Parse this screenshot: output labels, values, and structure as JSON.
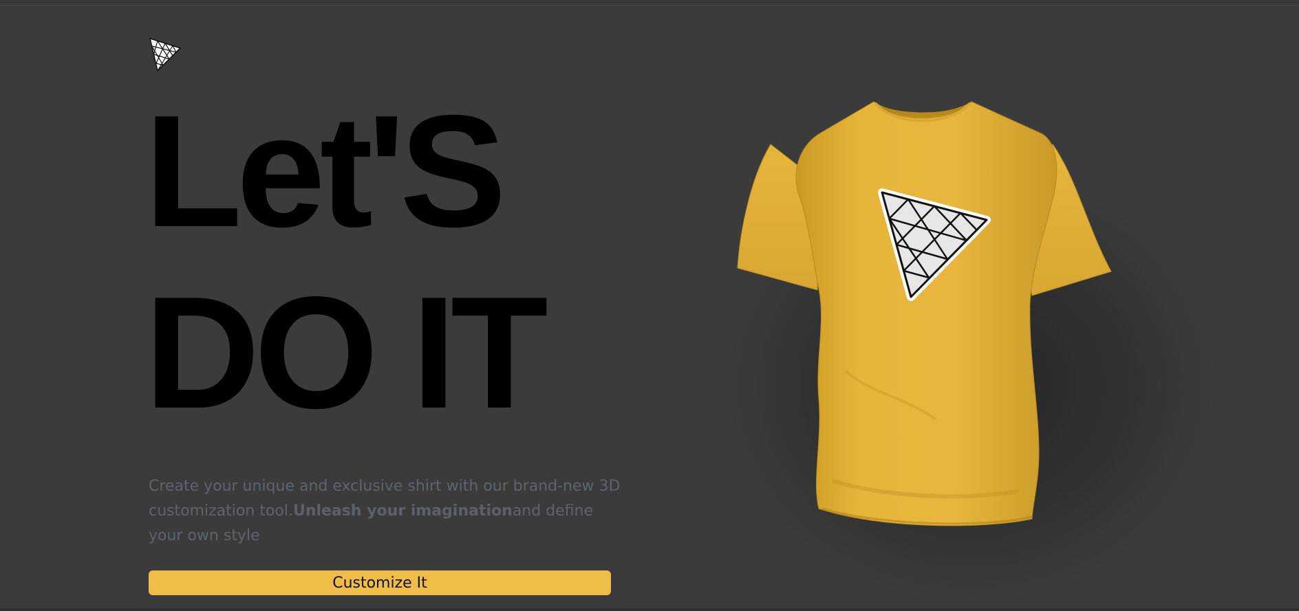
{
  "app": {
    "logo_icon": "threejs-triangle-logo-icon"
  },
  "hero": {
    "headline_line1": "Let'S",
    "headline_line2": "DO IT",
    "description_part1": "Create your unique and exclusive shirt with our brand-new 3D customization tool.",
    "description_bold": "Unleash your imagination",
    "description_part2": "and define your own style",
    "cta_label": "Customize It"
  },
  "preview": {
    "shirt_color": "#e8b63c",
    "decal_icon": "threejs-triangle-logo-icon"
  },
  "colors": {
    "background": "#3b3b3b",
    "accent": "#efbc47",
    "headline": "#000000",
    "description": "#5d6470"
  }
}
